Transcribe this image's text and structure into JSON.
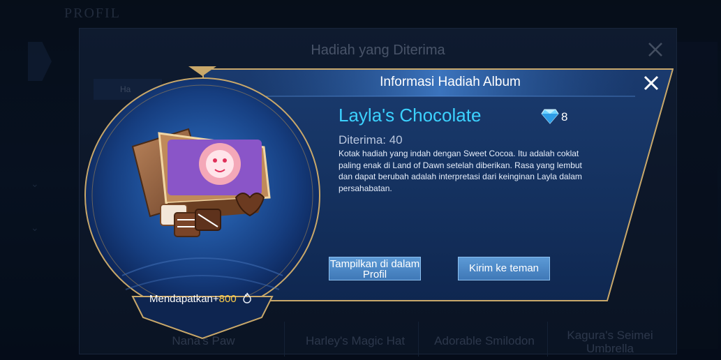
{
  "background": {
    "title": "PROFIL"
  },
  "outer_dialog": {
    "title": "Hadiah yang Diterima",
    "tab_label": "Ha",
    "bottom_items": [
      "Nana's Paw",
      "Harley's Magic Hat",
      "Adorable Smilodon",
      "Kagura's Seimei Umbrella"
    ]
  },
  "info_dialog": {
    "title": "Informasi Hadiah Album",
    "item_name": "Layla's Chocolate",
    "diamond_count": "8",
    "received": "Diterima: 40",
    "description": "Kotak hadiah yang indah dengan Sweet Cocoa. Itu adalah coklat paling enak di Land of Dawn setelah diberikan. Rasa yang lembut dan dapat berubah adalah interpretasi dari keinginan Layla dalam persahabatan.",
    "show_button": "Tampilkan di dalam Profil",
    "send_button": "Kirim ke teman",
    "earn_label": "Mendapatkan+",
    "earn_value": "800"
  },
  "icons": [
    "close-icon",
    "diamond-icon",
    "flame-icon",
    "chocolate-box-icon"
  ],
  "colors": {
    "accent_cyan": "#3cd2ff",
    "gold": "#c9a86a",
    "button_blue": "#4b88c8",
    "earn_gold": "#ffcf4a"
  }
}
